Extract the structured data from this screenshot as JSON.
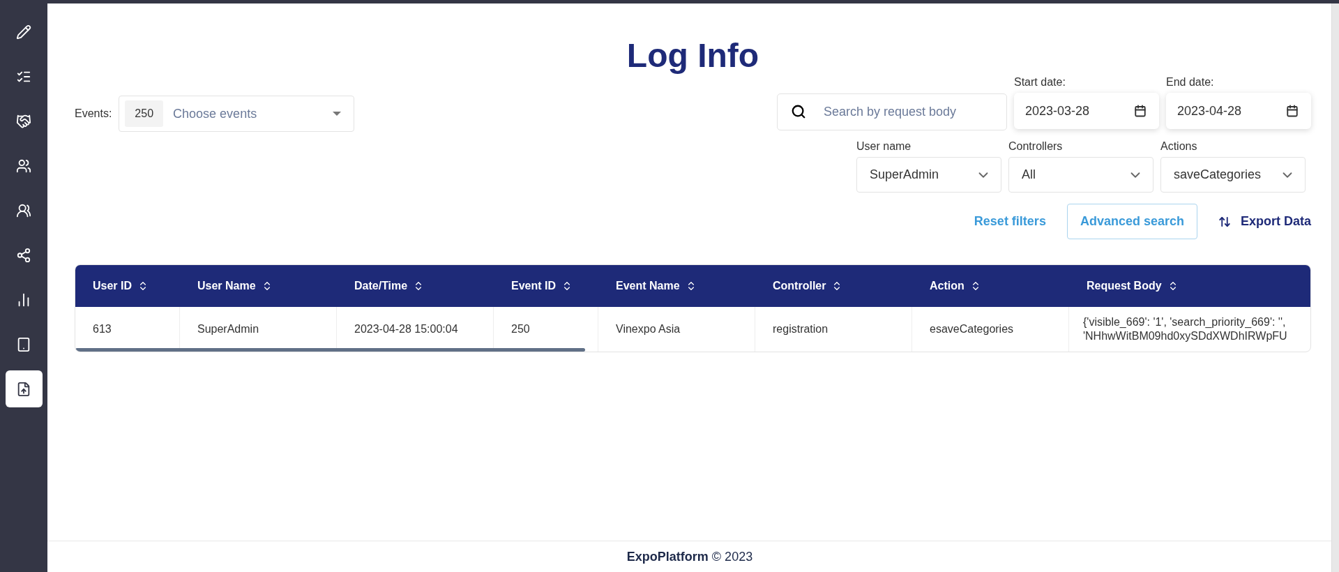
{
  "sidebar": {
    "items": [
      {
        "selected": false
      },
      {
        "selected": false
      },
      {
        "selected": false
      },
      {
        "selected": false
      },
      {
        "selected": false
      },
      {
        "selected": false
      },
      {
        "selected": false
      },
      {
        "selected": false
      },
      {
        "selected": true
      }
    ]
  },
  "title": "Log Info",
  "filters": {
    "events_label": "Events:",
    "events_chip": "250",
    "events_placeholder": "Choose events",
    "search_placeholder": "Search by request body",
    "start_date": {
      "label": "Start date:",
      "value": "2023-03-28"
    },
    "end_date": {
      "label": "End date:",
      "value": "2023-04-28"
    },
    "selects": [
      {
        "label": "User name",
        "value": "SuperAdmin"
      },
      {
        "label": "Controllers",
        "value": "All"
      },
      {
        "label": "Actions",
        "value": "saveCategories"
      }
    ],
    "reset": "Reset filters",
    "advanced": "Advanced search",
    "export": "Export Data"
  },
  "table": {
    "columns": [
      "User ID",
      "User Name",
      "Date/Time",
      "Event ID",
      "Event Name",
      "Controller",
      "Action",
      "Request Body"
    ],
    "rows": [
      [
        "613",
        "SuperAdmin",
        "2023-04-28 15:00:04",
        "250",
        "Vinexpo Asia",
        "registration",
        "esaveCategories",
        "{'visible_669': '1', 'search_priority_669': '',\n'NHhwWitBM09hd0xySDdXWDhIRWpFU"
      ]
    ]
  },
  "footer": {
    "brand": "ExpoPlatform",
    "copyright": "© 2023"
  }
}
